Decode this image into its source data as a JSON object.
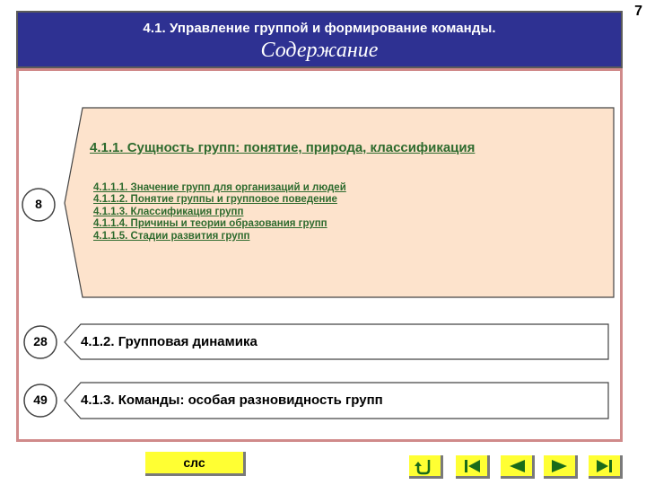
{
  "page_number": "7",
  "header": {
    "title": "4.1. Управление группой и формирование команды.",
    "subtitle": "Содержание"
  },
  "sections": [
    {
      "page": "8",
      "title": "4.1.1. Сущность групп: понятие, природа, классификация",
      "subitems": [
        "4.1.1.1. Значение групп для организаций и людей",
        "4.1.1.2. Понятие группы и групповое поведение",
        "4.1.1.3. Классификация групп",
        "4.1.1.4. Причины и теории образования групп",
        "4.1.1.5. Стадии развития групп"
      ]
    },
    {
      "page": "28",
      "title": "4.1.2. Групповая динамика"
    },
    {
      "page": "49",
      "title": "4.1.3. Команды: особая разновидность групп"
    }
  ],
  "footer": {
    "sls_label": "слс",
    "nav_icons": [
      "return-icon",
      "first-page-icon",
      "previous-icon",
      "next-icon",
      "last-page-icon"
    ]
  },
  "colors": {
    "header_bg": "#2e3192",
    "panel_bg": "#fde3cc",
    "link_green": "#2e6b2e",
    "button_yellow": "#ffff33"
  }
}
